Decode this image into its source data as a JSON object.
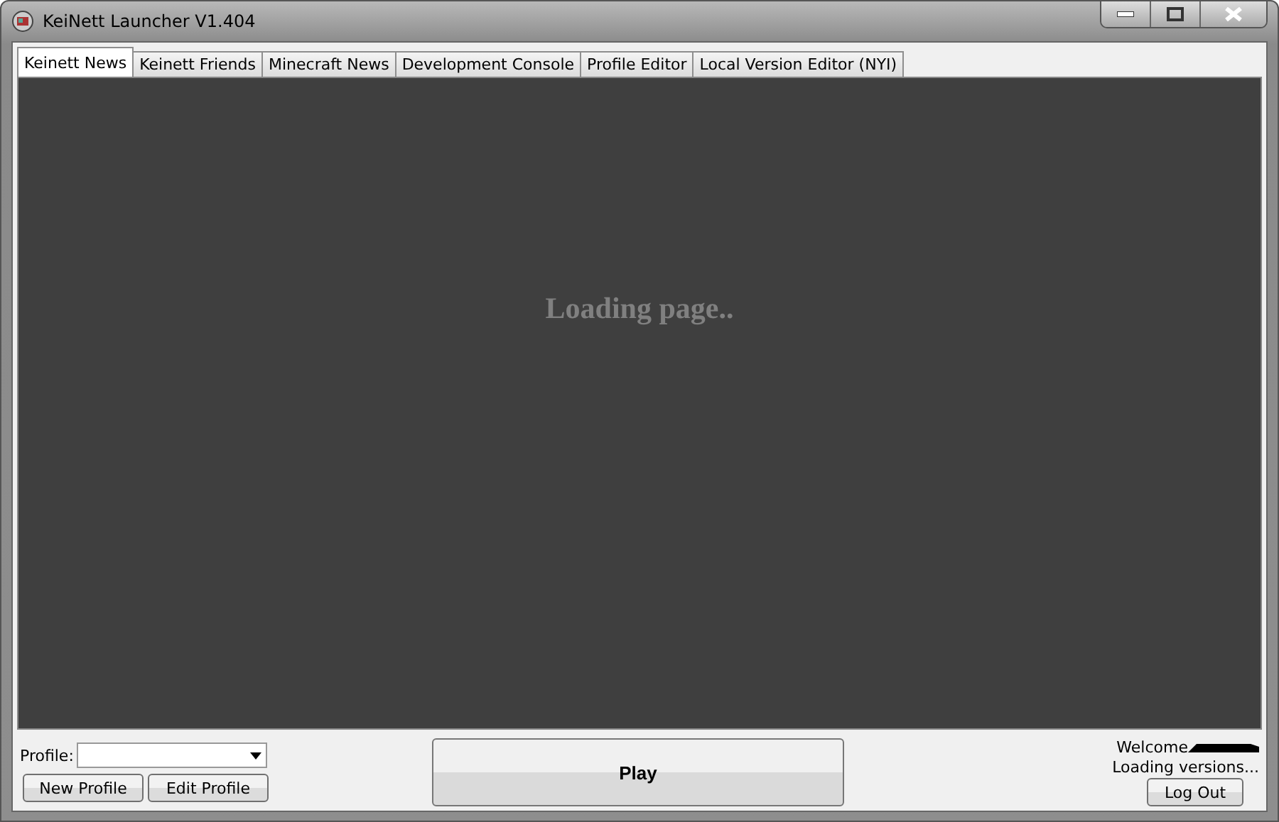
{
  "window": {
    "title": "KeiNett Launcher V1.404"
  },
  "tabs": [
    {
      "label": "Keinett News",
      "selected": true
    },
    {
      "label": "Keinett Friends",
      "selected": false
    },
    {
      "label": "Minecraft News",
      "selected": false
    },
    {
      "label": "Development Console",
      "selected": false
    },
    {
      "label": "Profile Editor",
      "selected": false
    },
    {
      "label": "Local Version Editor (NYI)",
      "selected": false
    }
  ],
  "content": {
    "message": "Loading page.."
  },
  "profile": {
    "label": "Profile:",
    "buttons": [
      "New Profile",
      "Edit Profile"
    ]
  },
  "play_button": "Play",
  "account": {
    "welcome": "Welcome",
    "status": "Loading versions...",
    "logout": "Log Out"
  }
}
